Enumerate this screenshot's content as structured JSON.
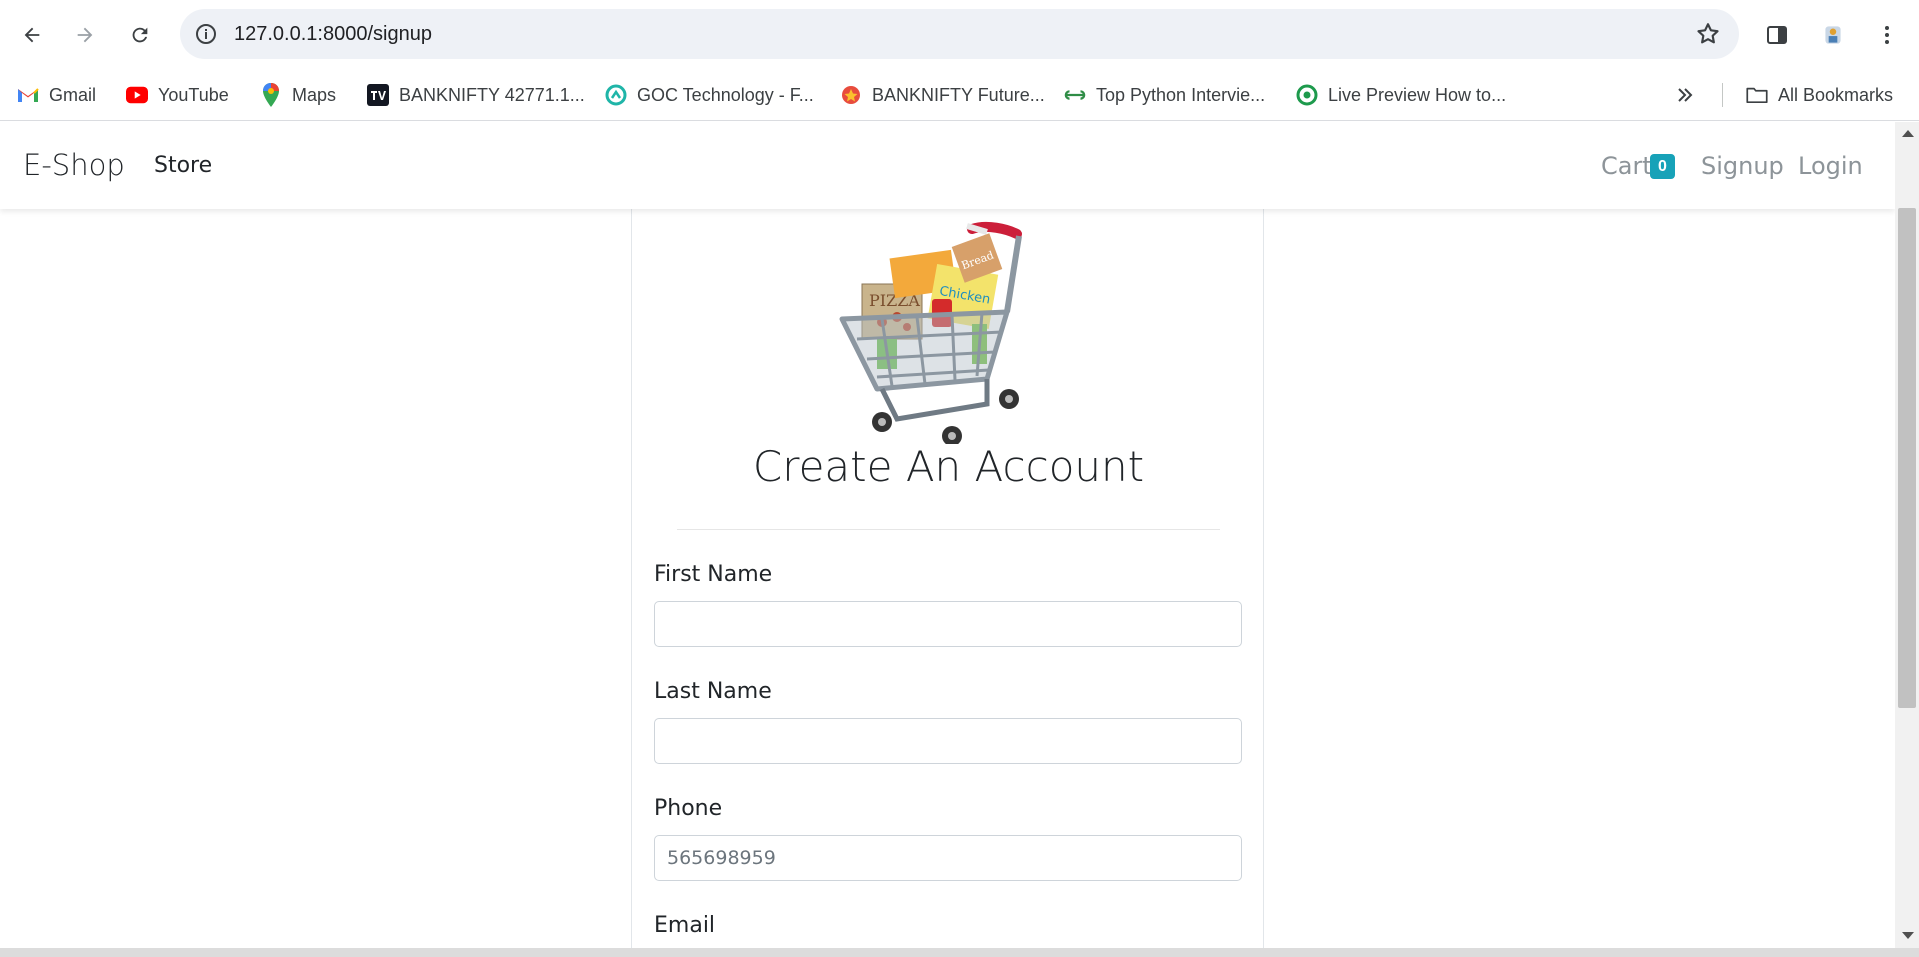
{
  "browser": {
    "url": "127.0.0.1:8000/signup",
    "bookmarks": [
      {
        "label": "Gmail",
        "icon": "gmail-icon"
      },
      {
        "label": "YouTube",
        "icon": "youtube-icon"
      },
      {
        "label": "Maps",
        "icon": "maps-icon"
      },
      {
        "label": "BANKNIFTY 42771.1...",
        "icon": "tradingview-icon"
      },
      {
        "label": "GOC Technology - F...",
        "icon": "goc-icon"
      },
      {
        "label": "BANKNIFTY Future...",
        "icon": "banknifty-icon"
      },
      {
        "label": "Top Python Intervie...",
        "icon": "geeks-icon"
      },
      {
        "label": "Live Preview How to...",
        "icon": "livepreview-icon"
      }
    ],
    "all_bookmarks": "All Bookmarks"
  },
  "navbar": {
    "brand": "E-Shop",
    "store": "Store",
    "cart": "Cart",
    "cart_count": "0",
    "signup": "Signup",
    "login": "Login"
  },
  "form": {
    "heading": "Create An Account",
    "first_name_label": "First Name",
    "first_name_value": "",
    "last_name_label": "Last Name",
    "last_name_value": "",
    "phone_label": "Phone",
    "phone_placeholder": "565698959",
    "email_label": "Email"
  },
  "colors": {
    "badge": "#17a2b8",
    "nav_muted": "#8d9499",
    "text": "#212529"
  }
}
